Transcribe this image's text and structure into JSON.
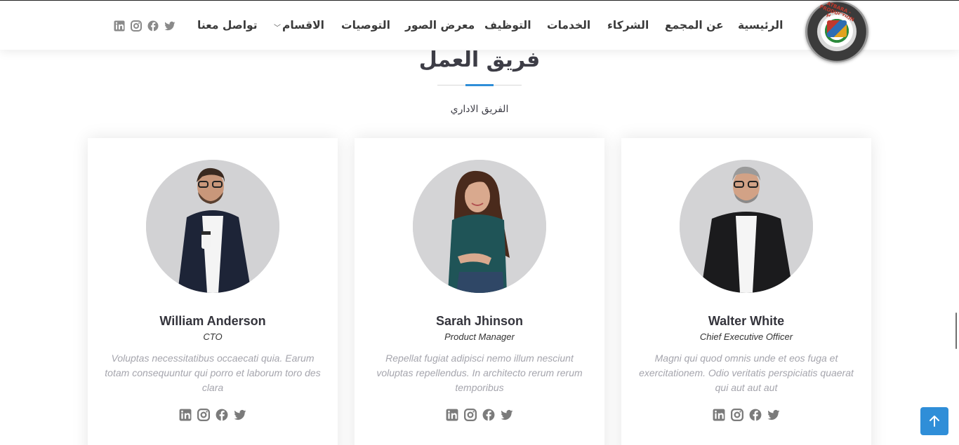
{
  "header": {
    "logo_text": "ATBARA - PRODUCTION HALLS",
    "nav": [
      {
        "label": "الرئيسية"
      },
      {
        "label": "عن المجمع"
      },
      {
        "label": "الشركاء"
      },
      {
        "label": "الخدمات"
      },
      {
        "label": "التوظيف"
      },
      {
        "label": "معرض الصور"
      },
      {
        "label": "التوصيات"
      },
      {
        "label": "الاقسام"
      },
      {
        "label": "تواصل معنا"
      }
    ],
    "socials": [
      "twitter-icon",
      "facebook-icon",
      "instagram-icon",
      "linkedin-icon"
    ]
  },
  "section": {
    "title": "فريق العمل",
    "subtitle": "الفريق الاداري",
    "accent_color": "#2f8ed8"
  },
  "team": [
    {
      "name": "William Anderson",
      "role": "CTO",
      "description": "Voluptas necessitatibus occaecati quia. Earum totam consequuntur qui porro et laborum toro des clara"
    },
    {
      "name": "Sarah Jhinson",
      "role": "Product Manager",
      "description": "Repellat fugiat adipisci nemo illum nesciunt voluptas repellendus. In architecto rerum rerum temporibus"
    },
    {
      "name": "Walter White",
      "role": "Chief Executive Officer",
      "description": "Magni qui quod omnis unde et eos fuga et exercitationem. Odio veritatis perspiciatis quaerat qui aut aut aut"
    }
  ]
}
